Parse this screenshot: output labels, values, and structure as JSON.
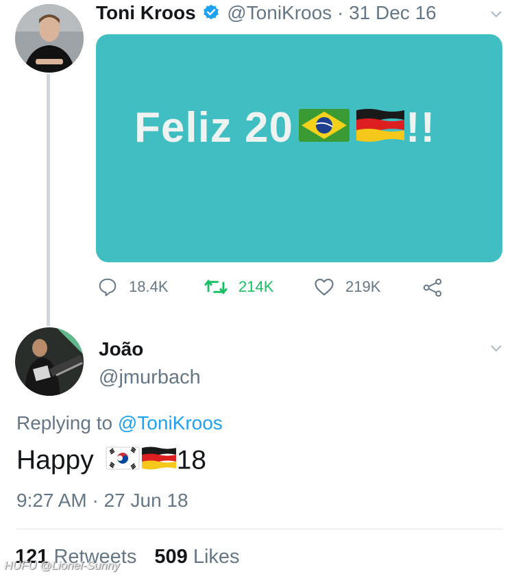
{
  "tweet": {
    "author_name": "Toni Kroos",
    "handle": "@ToniKroos",
    "date": "· 31 Dec 16",
    "image_text": "Feliz 20",
    "image_suffix": "!!",
    "image_bg": "#41bec1",
    "replies": "18.4K",
    "retweets": "214K",
    "likes": "219K"
  },
  "reply": {
    "author_name": "João",
    "handle": "@jmurbach",
    "replying_prefix": "Replying to",
    "replying_to": "@ToniKroos",
    "text_before": "Happy ",
    "text_after": "18",
    "timestamp": "9:27 AM · 27 Jun 18",
    "retweet_count": "121",
    "retweet_label": "Retweets",
    "like_count": "509",
    "like_label": "Likes"
  },
  "watermark": "HUFU @Lionel-Sunny",
  "colors": {
    "accent": "#1da1f2",
    "retweet_green": "#17bf63",
    "muted": "#657786"
  }
}
